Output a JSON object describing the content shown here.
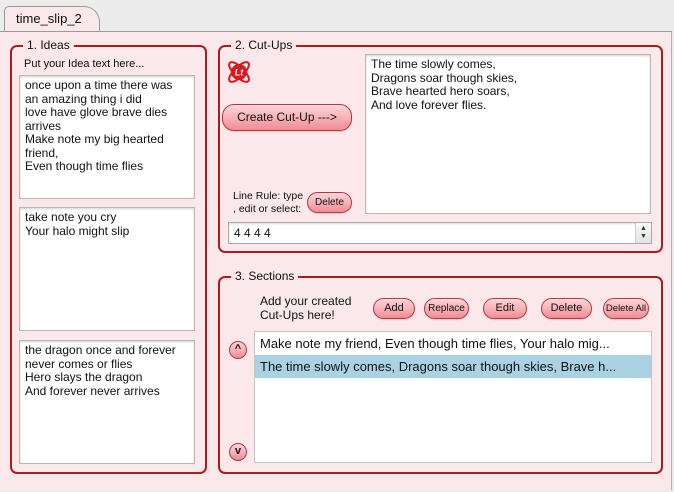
{
  "tab": {
    "label": "time_slip_2"
  },
  "ideas": {
    "legend": "1. Ideas",
    "hint": "Put your Idea text here...",
    "box1": "once upon a time there was\nan amazing thing i did\nlove have glove brave dies\narrives\nMake note my big hearted\nfriend,\nEven though time flies",
    "box2": "take note you cry\nYour halo might slip",
    "box3": "the dragon once and forever\nnever comes or flies\nHero slays the dragon\nAnd forever never arrives"
  },
  "cutups": {
    "legend": "2. Cut-Ups",
    "logo_text": "Lt",
    "logo_icon": "atom-logo-icon",
    "create_button": "Create Cut-Up --->",
    "output": "The time slowly comes,\nDragons soar though skies,\nBrave hearted hero soars,\nAnd love forever flies.",
    "line_rule_label": "Line Rule: type\n, edit or select:",
    "delete_button": "Delete",
    "line_rule_value": "4 4 4 4"
  },
  "sections": {
    "legend": "3. Sections",
    "hint": "Add your created\nCut-Ups here!",
    "buttons": {
      "add": "Add",
      "replace": "Replace",
      "edit": "Edit",
      "delete": "Delete",
      "delete_all": "Delete All"
    },
    "up_label": "^",
    "down_label": "v",
    "items": [
      {
        "text": "Make note my friend, Even though time flies, Your halo mig...",
        "selected": false
      },
      {
        "text": "The time slowly comes, Dragons soar though skies, Brave h...",
        "selected": true
      }
    ]
  },
  "colors": {
    "accent_border": "#a81d22",
    "panel_bg": "#fbe8ea",
    "button_fill": "#f08c95",
    "selection": "#a9d3e3"
  }
}
